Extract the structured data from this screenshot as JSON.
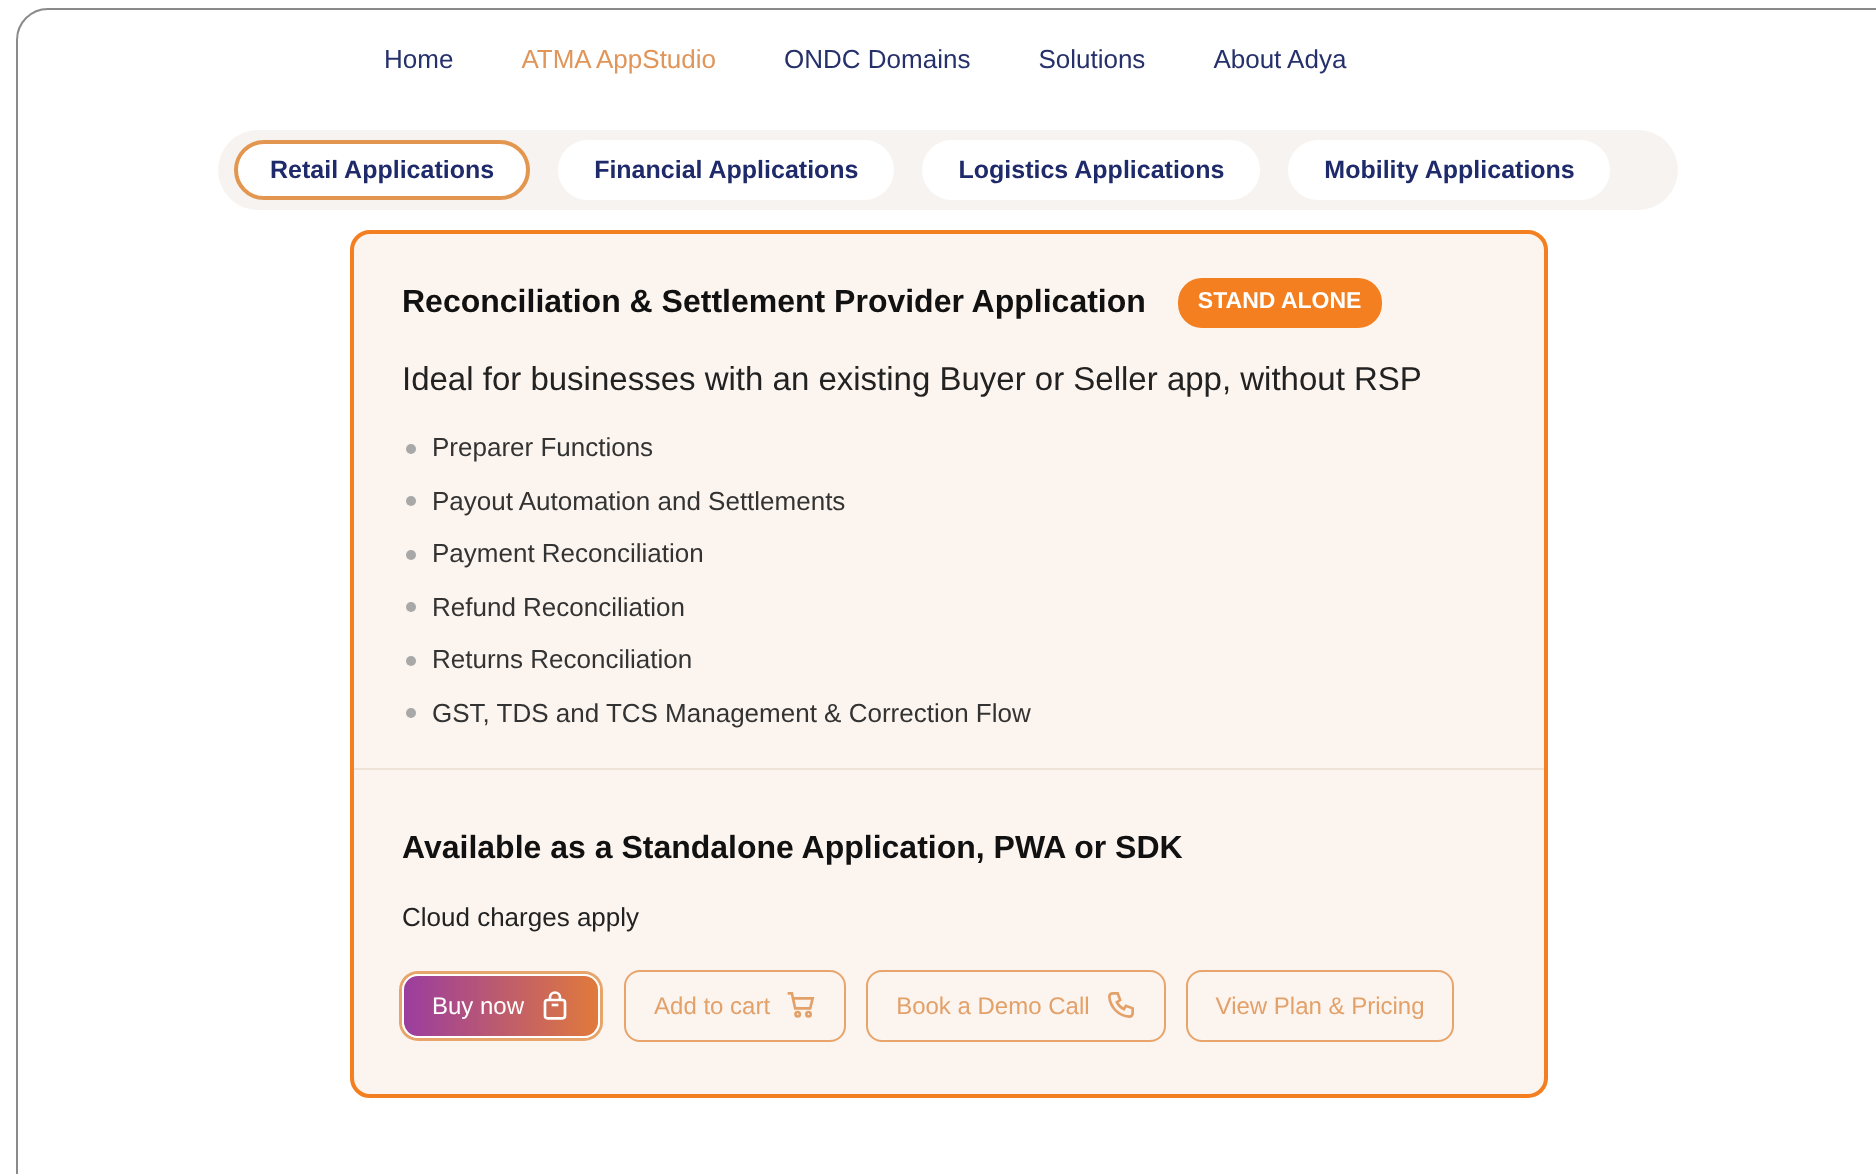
{
  "nav": [
    {
      "label": "Home",
      "selected": false
    },
    {
      "label": "ATMA AppStudio",
      "selected": true
    },
    {
      "label": "ONDC Domains",
      "selected": false
    },
    {
      "label": "Solutions",
      "selected": false
    },
    {
      "label": "About Adya",
      "selected": false
    }
  ],
  "tabs": [
    {
      "label": "Retail Applications",
      "selected": true
    },
    {
      "label": "Financial Applications",
      "selected": false
    },
    {
      "label": "Logistics Applications",
      "selected": false
    },
    {
      "label": "Mobility Applications",
      "selected": false
    }
  ],
  "card": {
    "title": "Reconciliation & Settlement Provider Application",
    "badge": "STAND ALONE",
    "subtitle": "Ideal for businesses with an existing Buyer or Seller app, without RSP",
    "features": [
      "Preparer Functions",
      "Payout Automation and Settlements",
      "Payment Reconciliation",
      "Refund Reconciliation",
      "Returns Reconciliation",
      "GST, TDS and TCS Management & Correction Flow"
    ],
    "availability": "Available as a Standalone Application, PWA or SDK",
    "note": "Cloud charges apply",
    "buttons": [
      {
        "label": "Buy now",
        "kind": "primary"
      },
      {
        "label": "Add to cart",
        "kind": "outline"
      },
      {
        "label": "Book a Demo Call",
        "kind": "outline"
      },
      {
        "label": "View Plan & Pricing",
        "kind": "outline"
      }
    ]
  }
}
